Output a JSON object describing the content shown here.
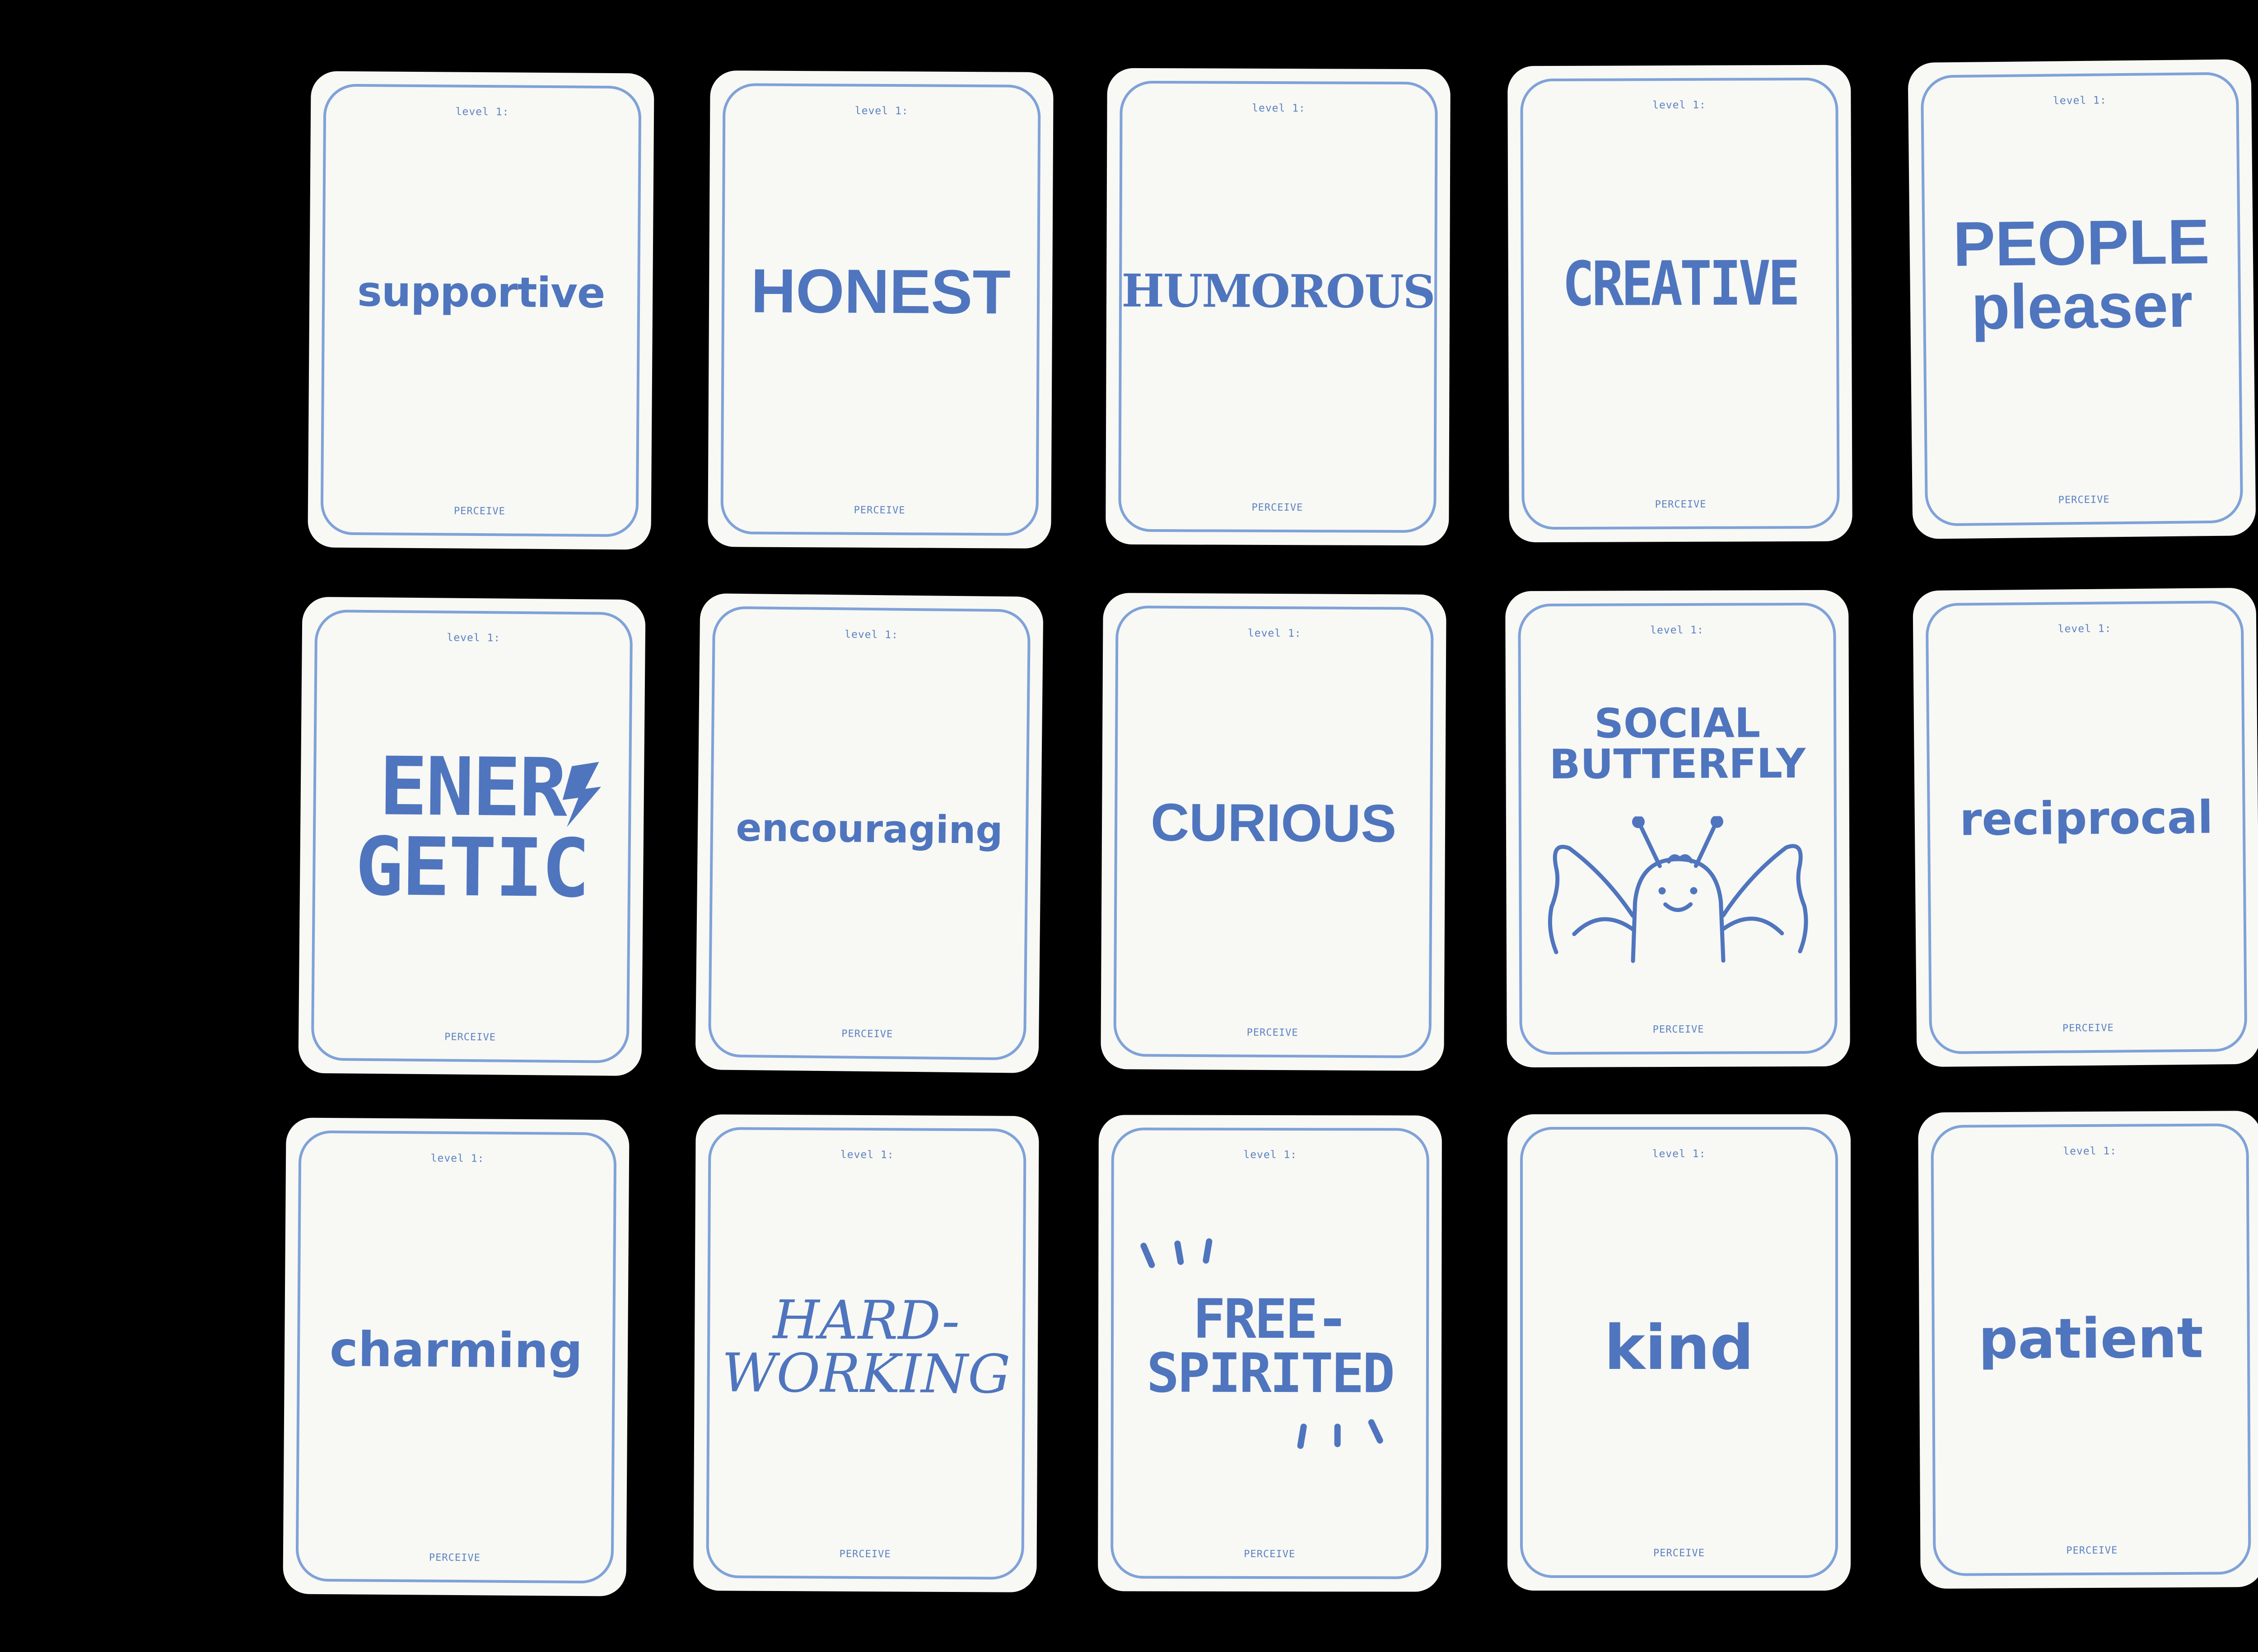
{
  "colors": {
    "background": "#000000",
    "card": "#f8f8f4",
    "accent": "#4f75be",
    "frame": "#7fa2d8"
  },
  "level_label": "level 1:",
  "footer_label": "PERCEIVE",
  "cards": [
    {
      "word": "supportive"
    },
    {
      "word": "HONEST"
    },
    {
      "word": "HUMOROUS"
    },
    {
      "word": "CREATIVE"
    },
    {
      "word": "PEOPLE\npleaser"
    },
    {
      "word": "ENER\nGETIC",
      "icon": "lightning-icon"
    },
    {
      "word": "encouraging"
    },
    {
      "word": "CURIOUS"
    },
    {
      "word": "SOCIAL\nBUTTERFLY",
      "icon": "butterfly-creature-icon"
    },
    {
      "word": "reciprocal"
    },
    {
      "word": "charming"
    },
    {
      "word": "HARD-\nWORKING"
    },
    {
      "word": "FREE-\nSPIRITED",
      "icon": "burst-rays-icon"
    },
    {
      "word": "kind"
    },
    {
      "word": "patient"
    }
  ]
}
